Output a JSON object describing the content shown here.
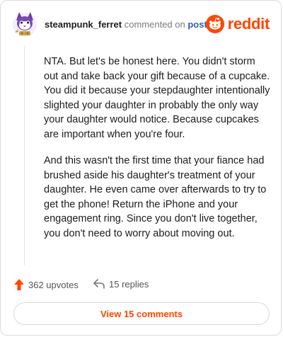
{
  "header": {
    "username": "steampunk_ferret",
    "commented_on": "commented on",
    "post_link": "post",
    "logo_text": "reddit"
  },
  "comment": {
    "paragraphs": [
      "NTA. But let's be honest here. You didn't storm out and take back your gift because of a cupcake. You did it because your stepdaughter intentionally slighted your daughter in probably the only way your daughter would notice. Because cupcakes are important when you're four.",
      "And this wasn't the first time that your fiance had brushed aside his daughter's treatment of your daughter. He even came over afterwards to try to get the phone! Return the iPhone and your engagement ring. Since you don't live together, you don't need to worry about moving out."
    ]
  },
  "actions": {
    "upvotes": "362 upvotes",
    "replies": "15 replies"
  },
  "view_button": "View 15 comments",
  "colors": {
    "brand": "#ff4500",
    "link": "#2f5fa8",
    "muted": "#7c7c7c"
  },
  "icons": [
    "avatar-ferret",
    "reddit-logo-icon",
    "upvote-arrow-icon",
    "reply-arrow-icon"
  ]
}
